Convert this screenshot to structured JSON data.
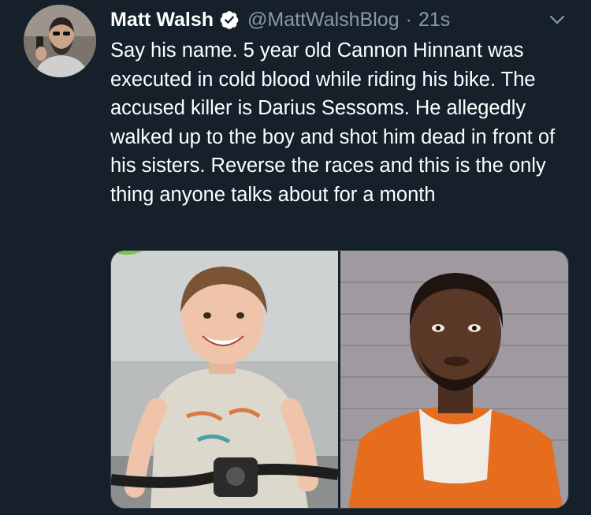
{
  "tweet": {
    "author_name": "Matt Walsh",
    "handle": "@MattWalshBlog",
    "separator": "·",
    "time": "21s",
    "text": "Say his name. 5 year old Cannon Hinnant was executed in cold blood while riding his bike. The accused killer is Darius Sessoms. He allegedly walked up to the boy and shot him dead in front of his sisters. Reverse the races and this is the only thing anyone talks about for a month",
    "verified": true
  },
  "media": {
    "photo_count": 2
  },
  "colors": {
    "background": "#15202b",
    "secondary_text": "#8899a6",
    "verified_blue": "#ffffff",
    "border": "#38444d"
  },
  "icons": {
    "verified": "verified-badge-icon",
    "caret": "chevron-down-icon"
  }
}
